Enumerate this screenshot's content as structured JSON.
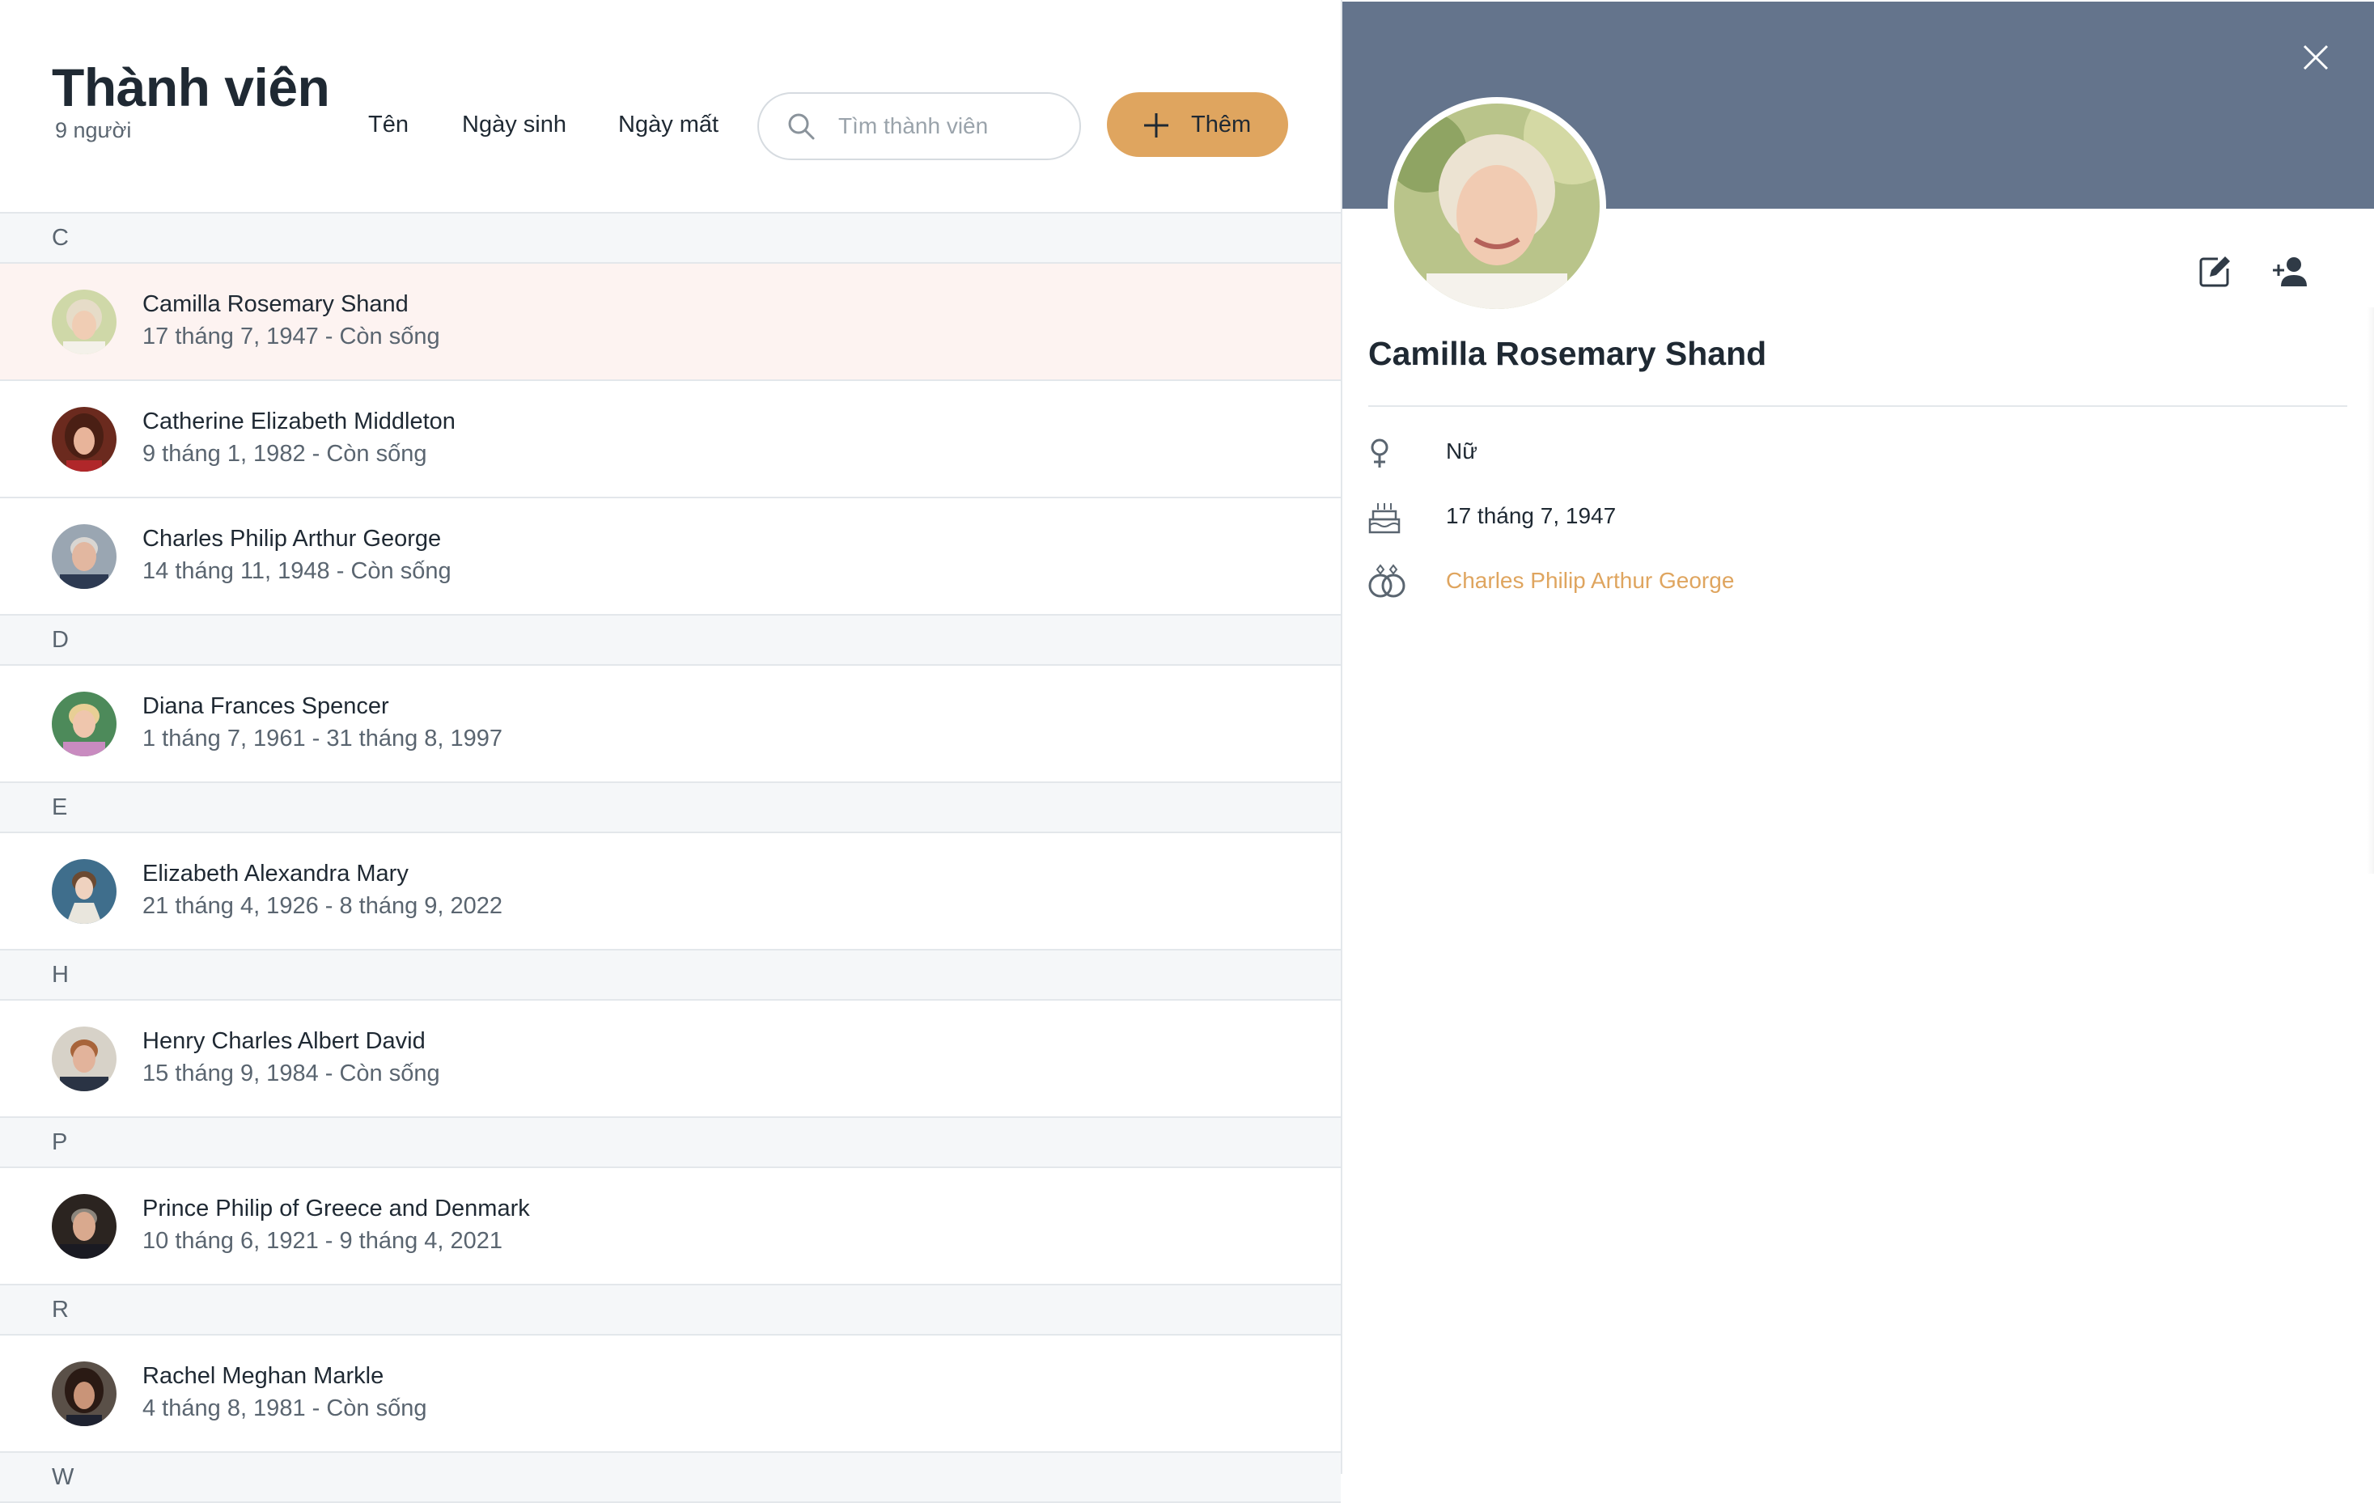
{
  "header": {
    "title": "Thành viên",
    "count": "9 người",
    "sort": [
      "Tên",
      "Ngày sinh",
      "Ngày mất"
    ],
    "search_placeholder": "Tìm thành viên",
    "add_label": "Thêm"
  },
  "groups": [
    "C",
    "D",
    "E",
    "H",
    "P",
    "R",
    "W"
  ],
  "members": [
    {
      "name": "Camilla Rosemary Shand",
      "dates": "17 tháng 7, 1947 - Còn sống"
    },
    {
      "name": "Catherine Elizabeth Middleton",
      "dates": "9 tháng 1, 1982 - Còn sống"
    },
    {
      "name": "Charles Philip Arthur George",
      "dates": "14 tháng 11, 1948 - Còn sống"
    },
    {
      "name": "Diana Frances Spencer",
      "dates": "1 tháng 7, 1961 - 31 tháng 8, 1997"
    },
    {
      "name": "Elizabeth Alexandra Mary",
      "dates": "21 tháng 4, 1926 - 8 tháng 9, 2022"
    },
    {
      "name": "Henry Charles Albert David",
      "dates": "15 tháng 9, 1984 - Còn sống"
    },
    {
      "name": "Prince Philip of Greece and Denmark",
      "dates": "10 tháng 6, 1921 - 9 tháng 4, 2021"
    },
    {
      "name": "Rachel Meghan Markle",
      "dates": "4 tháng 8, 1981 - Còn sống"
    }
  ],
  "detail": {
    "name": "Camilla Rosemary Shand",
    "gender": "Nữ",
    "birth": "17 tháng 7, 1947",
    "spouse": "Charles Philip Arthur George"
  },
  "colors": {
    "accent": "#dfa55f",
    "banner": "#64748c",
    "selected_row": "#fdf3f1",
    "group_bg": "#f5f7f9"
  }
}
